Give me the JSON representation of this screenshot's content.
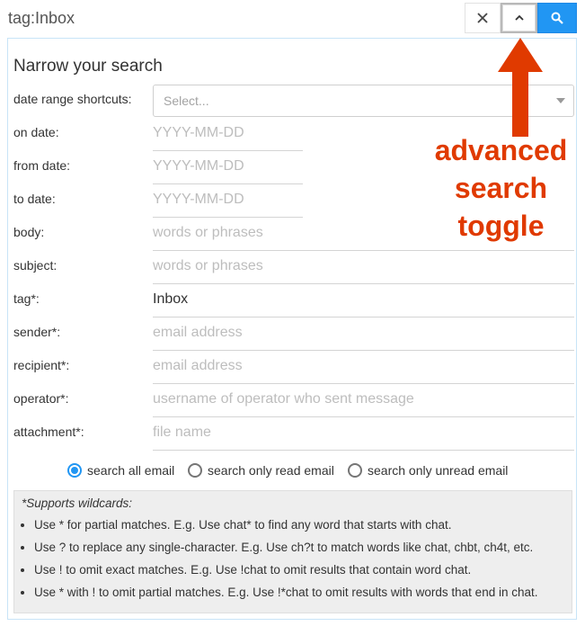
{
  "search": {
    "query": "tag:Inbox",
    "clear_icon": "close-icon",
    "toggle_icon": "chevron-up-icon",
    "search_icon": "search-icon",
    "search_button_color": "#2196f3"
  },
  "panel": {
    "title": "Narrow your search",
    "date_shortcuts": {
      "label": "date range shortcuts:",
      "placeholder": "Select..."
    },
    "fields": [
      {
        "label": "on date:",
        "value": "YYYY-MM-DD",
        "filled": false
      },
      {
        "label": "from date:",
        "value": "YYYY-MM-DD",
        "filled": false
      },
      {
        "label": "to date:",
        "value": "YYYY-MM-DD",
        "filled": false
      },
      {
        "label": "body:",
        "value": "words or phrases",
        "filled": false
      },
      {
        "label": "subject:",
        "value": "words or phrases",
        "filled": false
      },
      {
        "label": "tag*:",
        "value": "Inbox",
        "filled": true
      },
      {
        "label": "sender*:",
        "value": "email address",
        "filled": false
      },
      {
        "label": "recipient*:",
        "value": "email address",
        "filled": false
      },
      {
        "label": "operator*:",
        "value": "username of operator who sent message",
        "filled": false
      },
      {
        "label": "attachment*:",
        "value": "file name",
        "filled": false
      }
    ],
    "radios": [
      {
        "label": "search all email",
        "selected": true
      },
      {
        "label": "search only read email",
        "selected": false
      },
      {
        "label": "search only unread email",
        "selected": false
      }
    ],
    "notes": {
      "title": "*Supports wildcards:",
      "items": [
        "Use * for partial matches. E.g. Use chat* to find any word that starts with chat.",
        "Use ? to replace any single-character. E.g. Use ch?t to match words like chat, chbt, ch4t, etc.",
        "Use ! to omit exact matches. E.g. Use !chat to omit results that contain word chat.",
        "Use * with ! to omit partial matches. E.g. Use !*chat to omit results with words that end in chat."
      ]
    }
  },
  "annotation": {
    "line1": "advanced",
    "line2": "search",
    "line3": "toggle",
    "color": "#e03a00"
  }
}
